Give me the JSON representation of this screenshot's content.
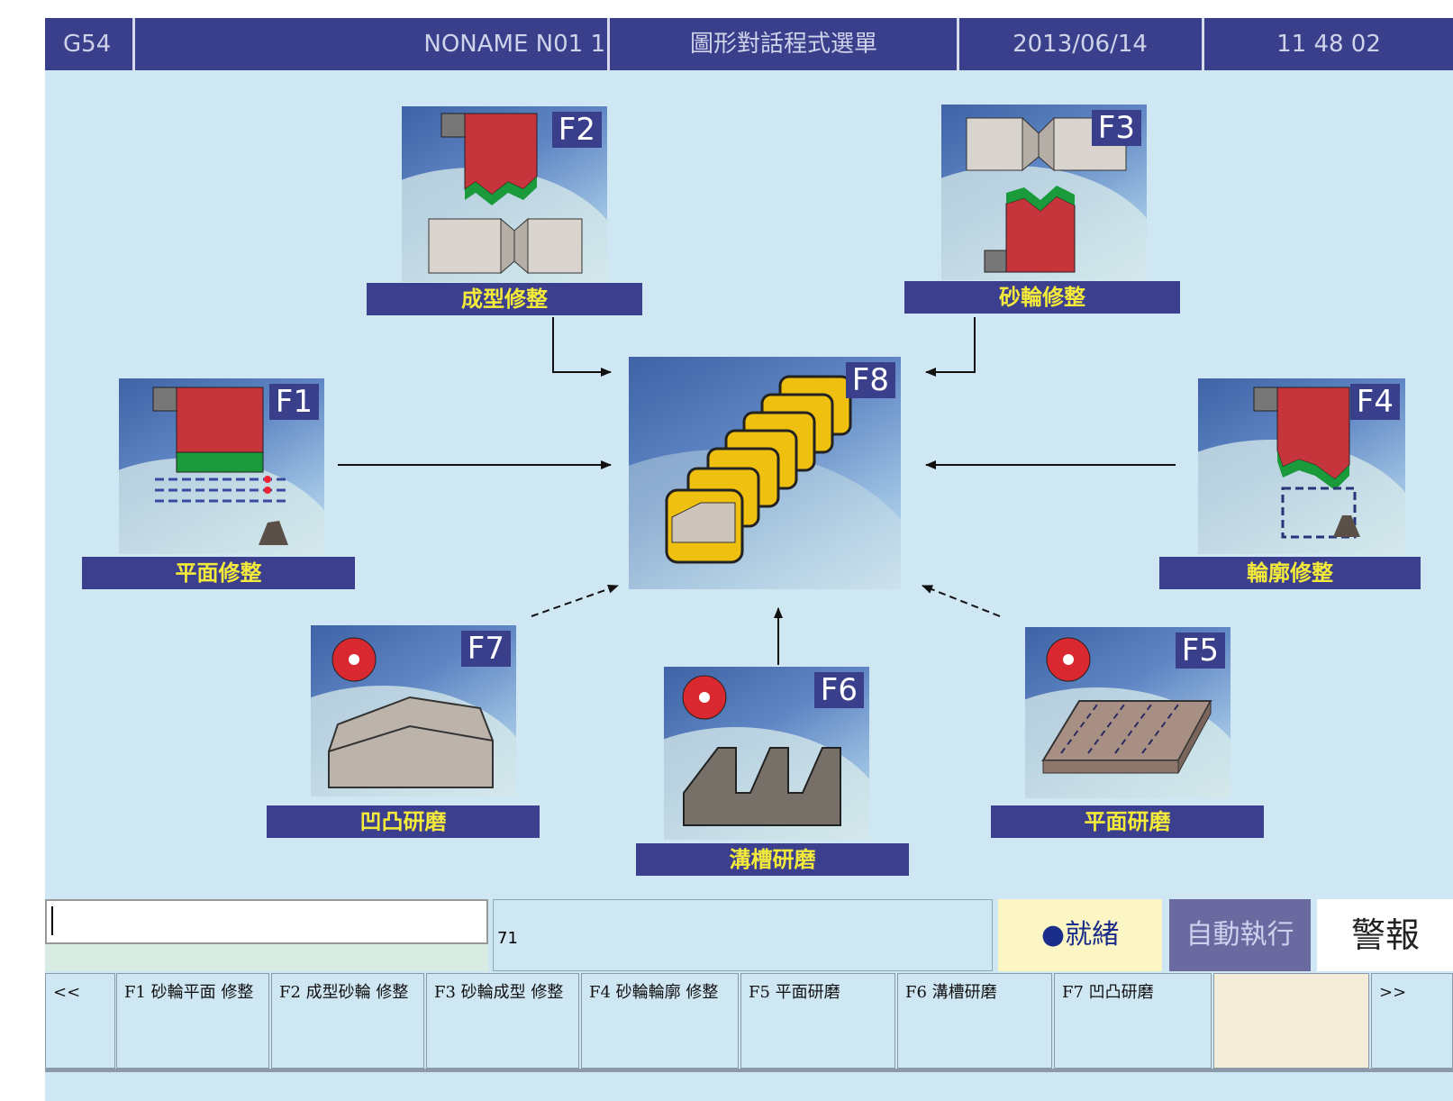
{
  "header": {
    "coord": "G54",
    "program": "NONAME N01 1",
    "title": "圖形對話程式選單",
    "date": "2013/06/14",
    "time": "11 48 02"
  },
  "modules": {
    "f1": {
      "key": "F1",
      "label": "平面修整"
    },
    "f2": {
      "key": "F2",
      "label": "成型修整"
    },
    "f3": {
      "key": "F3",
      "label": "砂輪修整"
    },
    "f4": {
      "key": "F4",
      "label": "輪廓修整"
    },
    "f5": {
      "key": "F5",
      "label": "平面研磨"
    },
    "f6": {
      "key": "F6",
      "label": "溝槽研磨"
    },
    "f7": {
      "key": "F7",
      "label": "凹凸研磨"
    },
    "f8": {
      "key": "F8"
    }
  },
  "status": {
    "command_value": "",
    "message": "71",
    "ready": "●就緒",
    "mode": "自動執行",
    "alarm": "警報"
  },
  "softkeys": {
    "prev": "<<",
    "f1": "F1 砂輪平面 修整",
    "f2": "F2 成型砂輪 修整",
    "f3": "F3 砂輪成型 修整",
    "f4": "F4 砂輪輪廓 修整",
    "f5": "F5 平面研磨",
    "f6": "F6 溝槽研磨",
    "f7": "F7 凹凸研磨",
    "blank": "",
    "next": ">>"
  },
  "colors": {
    "header_bg": "#3a3f8c",
    "label_text": "#f4ea3a",
    "screen_bg": "#cfe6f3"
  }
}
